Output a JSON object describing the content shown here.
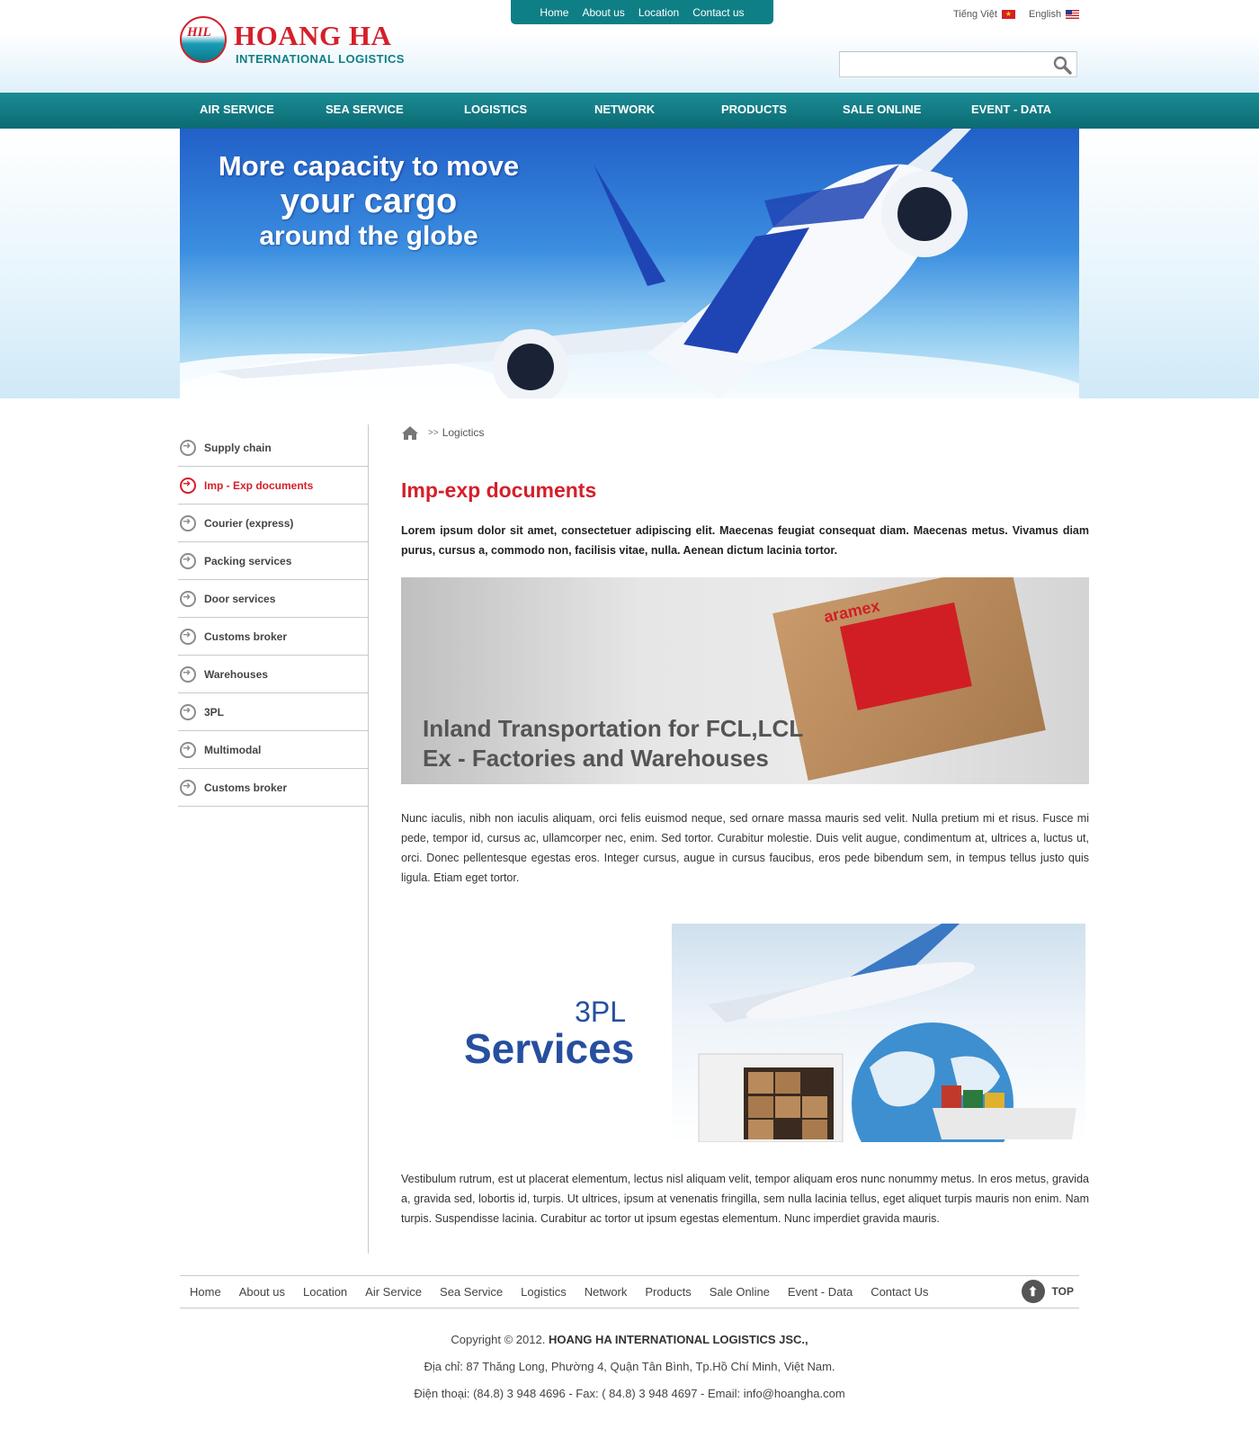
{
  "header": {
    "logo_mark": "HIL",
    "logo_name": "HOANG HA",
    "logo_sub": "INTERNATIONAL LOGISTICS",
    "top_nav": [
      "Home",
      "About us",
      "Location",
      "Contact us"
    ],
    "lang_vi": "Tiếng Việt",
    "lang_en": "English",
    "search_placeholder": ""
  },
  "main_nav": [
    "AIR SERVICE",
    "SEA SERVICE",
    "LOGISTICS",
    "NETWORK",
    "PRODUCTS",
    "SALE ONLINE",
    "EVENT - DATA"
  ],
  "banner": {
    "line1": "More capacity to move",
    "line2": "your cargo",
    "line3": "around the globe"
  },
  "sidebar": {
    "items": [
      {
        "label": "Supply chain",
        "active": false
      },
      {
        "label": "Imp - Exp documents",
        "active": true
      },
      {
        "label": "Courier (express)",
        "active": false
      },
      {
        "label": "Packing services",
        "active": false
      },
      {
        "label": "Door services",
        "active": false
      },
      {
        "label": "Customs broker",
        "active": false
      },
      {
        "label": "Warehouses",
        "active": false
      },
      {
        "label": "3PL",
        "active": false
      },
      {
        "label": "Multimodal",
        "active": false
      },
      {
        "label": "Customs broker",
        "active": false
      }
    ]
  },
  "content": {
    "breadcrumb_sep": ">>",
    "breadcrumb": "Logictics",
    "title": "Imp-exp documents",
    "lead": "Lorem ipsum dolor sit amet, consectetuer adipiscing elit. Maecenas feugiat consequat diam. Maecenas metus. Vivamus diam purus, cursus a, commodo non, facilisis vitae, nulla. Aenean dictum lacinia tortor.",
    "image1_brand": "aramex",
    "image1_line1": "Inland Transportation for FCL,LCL",
    "image1_line2": "Ex - Factories and Warehouses",
    "para1": "Nunc iaculis, nibh non iaculis aliquam, orci felis euismod neque, sed ornare massa mauris sed velit. Nulla pretium mi et risus. Fusce mi pede, tempor id, cursus ac, ullamcorper nec, enim. Sed tortor. Curabitur molestie. Duis velit augue, condimentum at, ultrices a, luctus ut, orci. Donec pellentesque egestas eros. Integer cursus, augue in cursus faucibus, eros pede bibendum sem, in tempus tellus justo quis ligula. Etiam eget tortor.",
    "image2_line1": "3PL",
    "image2_line2": "Services",
    "para2": "Vestibulum rutrum, est ut placerat elementum, lectus nisl aliquam velit, tempor aliquam eros nunc nonummy metus. In eros metus, gravida a, gravida sed, lobortis id, turpis. Ut ultrices, ipsum at venenatis fringilla, sem nulla lacinia tellus, eget aliquet turpis mauris non enim. Nam turpis. Suspendisse lacinia. Curabitur ac tortor ut ipsum egestas elementum. Nunc imperdiet gravida mauris."
  },
  "footer": {
    "nav": [
      "Home",
      "About us",
      "Location",
      "Air Service",
      "Sea Service",
      "Logistics",
      "Network",
      "Products",
      "Sale Online",
      "Event - Data",
      "Contact Us"
    ],
    "top_label": "TOP",
    "copyright_prefix": "Copyright © 2012.",
    "company": "HOANG HA INTERNATIONAL LOGISTICS JSC.,",
    "address": "Địa chỉ: 87 Thăng Long, Phường 4, Quận Tân Bình, Tp.Hồ Chí Minh, Việt Nam.",
    "contact": "Điện thoại: (84.8) 3 948 4696 - Fax: ( 84.8) 3 948 4697 - Email: info@hoangha.com"
  },
  "colors": {
    "teal": "#0f7f86",
    "red": "#d51f2a",
    "footer_text": "#444444"
  }
}
